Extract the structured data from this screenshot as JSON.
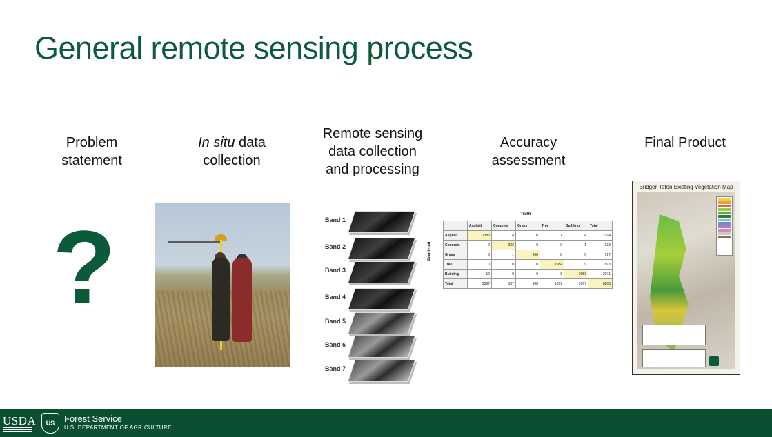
{
  "slide": {
    "title": "General remote sensing process"
  },
  "steps": [
    {
      "label_line1": "Problem",
      "label_line2": "statement"
    },
    {
      "label_italic": "In situ",
      "label_rest": " data",
      "label_line2": "collection"
    },
    {
      "label_line1": "Remote sensing",
      "label_line2": "data collection",
      "label_line3": "and processing"
    },
    {
      "label_line1": "Accuracy",
      "label_line2": "assessment"
    },
    {
      "label_line1": "Final Product"
    }
  ],
  "problem_symbol": "?",
  "bands": [
    "Band 1",
    "Band 2",
    "Band 3",
    "Band 4",
    "Band 5",
    "Band 6",
    "Band 7"
  ],
  "accuracy_table": {
    "truth_label": "Truth",
    "predicted_label": "Predicted",
    "columns": [
      "",
      "Asphalt",
      "Concrete",
      "Grass",
      "Tree",
      "Building",
      "Total"
    ],
    "rows": [
      [
        "Asphalt",
        "2385",
        "4",
        "0",
        "1",
        "4",
        "2394"
      ],
      [
        "Concrete",
        "0",
        "332",
        "0",
        "0",
        "1",
        "333"
      ],
      [
        "Grass",
        "0",
        "1",
        "908",
        "8",
        "0",
        "917"
      ],
      [
        "Tree",
        "0",
        "0",
        "0",
        "1084",
        "9",
        "1093"
      ],
      [
        "Building",
        "12",
        "0",
        "0",
        "6",
        "2053",
        "2071"
      ],
      [
        "Total",
        "2397",
        "337",
        "908",
        "1099",
        "2067",
        "6808"
      ]
    ]
  },
  "final_map": {
    "title": "Bridger-Teton Existing Vegetation Map"
  },
  "footer": {
    "usda_logo": "USDA",
    "forest_service": "Forest Service",
    "department": "U.S. DEPARTMENT OF AGRICULTURE",
    "shield_text": "US"
  },
  "colors": {
    "brand_green": "#0b5a3a",
    "footer_green": "#0b4f32"
  }
}
